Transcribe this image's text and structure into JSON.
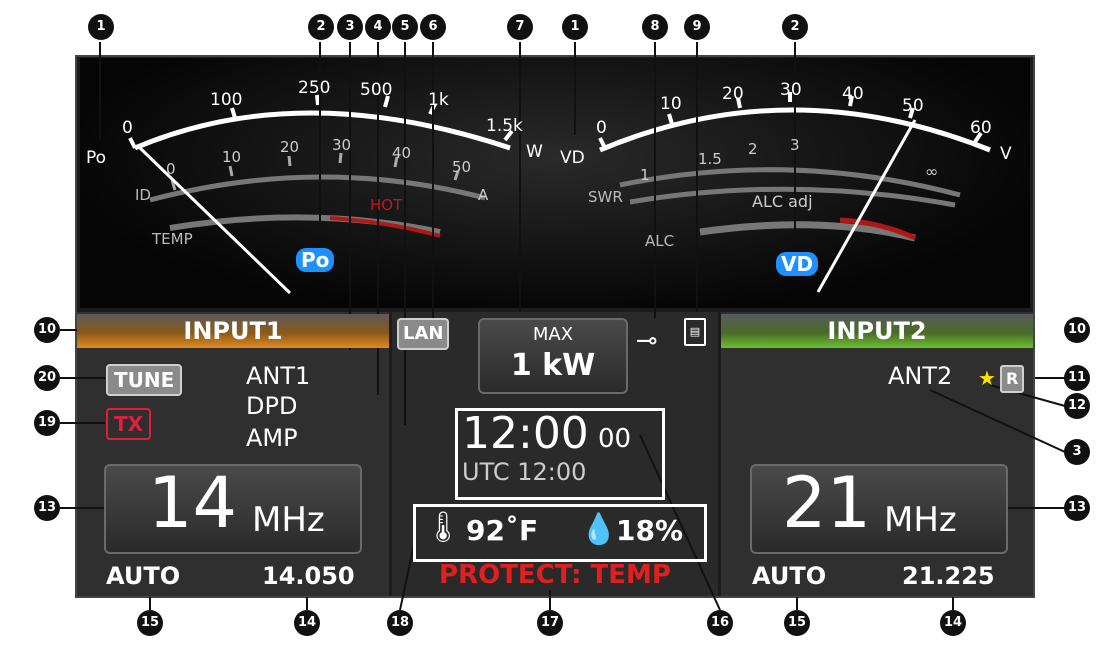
{
  "meter_left": {
    "po_label": "Po",
    "ticks_w": [
      "0",
      "100",
      "250",
      "500",
      "1k",
      "1.5k"
    ],
    "unit_w": "W",
    "id_label": "ID",
    "ticks_a": [
      "0",
      "10",
      "20",
      "30",
      "40",
      "50"
    ],
    "unit_a": "A",
    "temp_label": "TEMP",
    "hot_label": "HOT",
    "badge": "Po"
  },
  "meter_right": {
    "vd_label": "VD",
    "ticks_v": [
      "0",
      "10",
      "20",
      "30",
      "40",
      "50",
      "60"
    ],
    "unit_v": "V",
    "swr_label": "SWR",
    "ticks_swr": [
      "1",
      "1.5",
      "2",
      "3",
      "∞"
    ],
    "alc_adj_label": "ALC adj",
    "alc_label": "ALC",
    "badge": "VD"
  },
  "left_panel": {
    "input_label": "INPUT1",
    "tune_label": "TUNE",
    "tx_label": "TX",
    "ant": "ANT1",
    "dpd": "DPD",
    "amp": "AMP",
    "band_value": "14",
    "band_unit": "MHz",
    "mode": "AUTO",
    "freq": "14.050"
  },
  "center_panel": {
    "lan_label": "LAN",
    "max_label": "MAX",
    "power_label": "1 kW",
    "clock_time": "12:00",
    "clock_seconds": "00",
    "utc": "UTC 12:00",
    "temperature": "92˚F",
    "humidity": "18%",
    "protect": "PROTECT: TEMP"
  },
  "right_panel": {
    "input_label": "INPUT2",
    "ant": "ANT2",
    "r_label": "R",
    "band_value": "21",
    "band_unit": "MHz",
    "mode": "AUTO",
    "freq": "21.225"
  },
  "callouts": [
    "1",
    "2",
    "3",
    "4",
    "5",
    "6",
    "7",
    "1",
    "2",
    "8",
    "9",
    "10",
    "10",
    "20",
    "11",
    "12",
    "19",
    "3",
    "13",
    "13",
    "15",
    "14",
    "18",
    "17",
    "16",
    "15",
    "14"
  ],
  "colors": {
    "input1_accent": "#e08a20",
    "input2_accent": "#6cc030",
    "badge_blue": "#1e90ff",
    "tx_red": "#e0203a",
    "protect_red": "#e02020",
    "star_yellow": "#ffe000",
    "hot_red": "#c01818"
  }
}
